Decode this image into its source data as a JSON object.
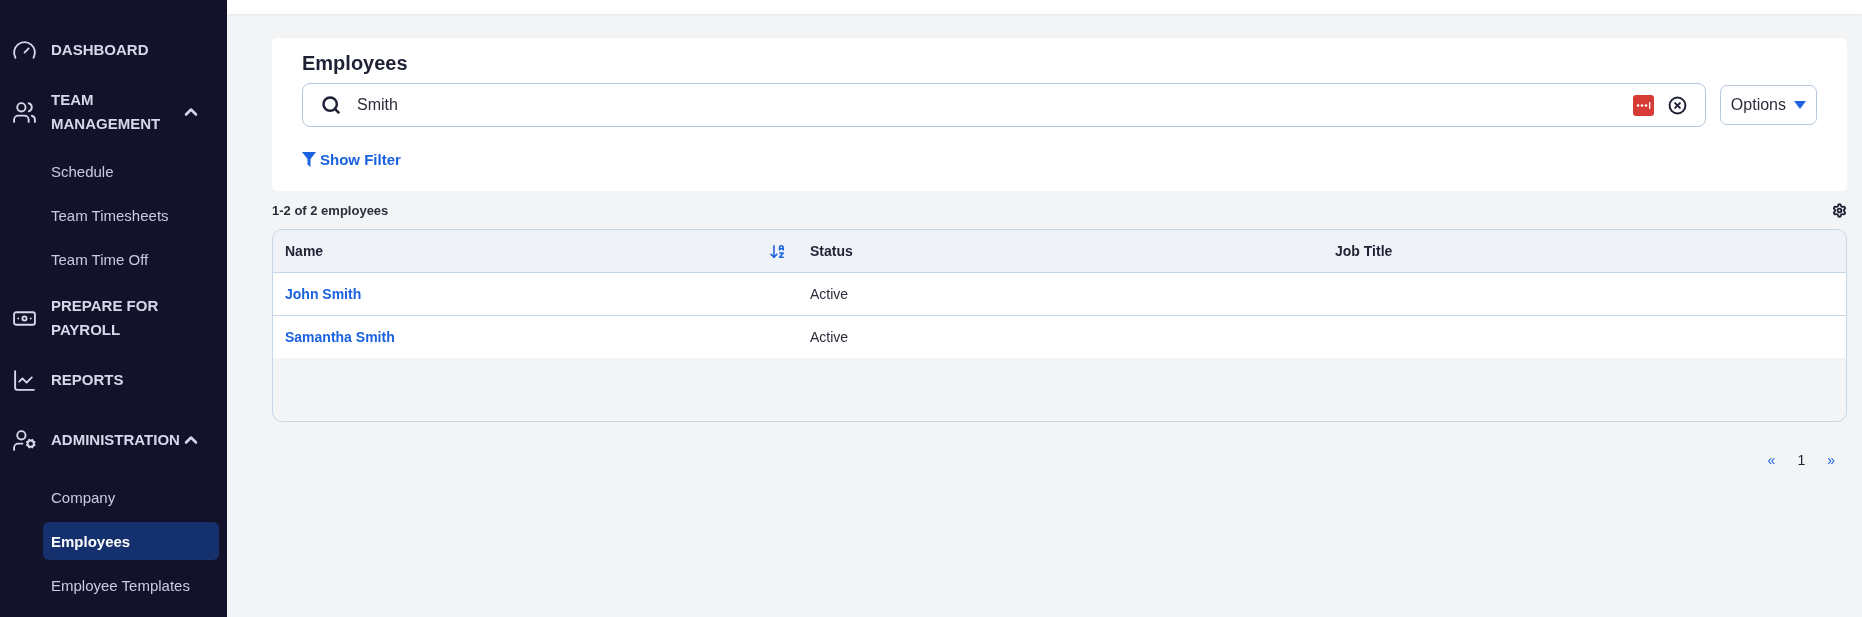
{
  "sidebar": {
    "sections": [
      {
        "label": "DASHBOARD"
      },
      {
        "label": "TEAM MANAGEMENT",
        "expanded": true,
        "items": [
          {
            "label": "Schedule",
            "selected": false
          },
          {
            "label": "Team Timesheets",
            "selected": false
          },
          {
            "label": "Team Time Off",
            "selected": false
          }
        ]
      },
      {
        "label": "PREPARE FOR PAYROLL"
      },
      {
        "label": "REPORTS"
      },
      {
        "label": "ADMINISTRATION",
        "expanded": true,
        "items": [
          {
            "label": "Company",
            "selected": false
          },
          {
            "label": "Employees",
            "selected": true
          },
          {
            "label": "Employee Templates",
            "selected": false
          }
        ]
      }
    ]
  },
  "page": {
    "title": "Employees",
    "search": {
      "value": "Smith"
    },
    "options_button": "Options",
    "filter_link": "Show Filter"
  },
  "results_count": "1-2 of 2 employees",
  "table": {
    "columns": [
      {
        "label": "Name",
        "sorted": true
      },
      {
        "label": "Status",
        "sorted": false
      },
      {
        "label": "Job Title",
        "sorted": false
      }
    ],
    "rows": [
      {
        "name": "John Smith",
        "status": "Active"
      },
      {
        "name": "Samantha Smith",
        "status": "Active"
      }
    ]
  },
  "pagination": {
    "prev": "«",
    "next": "»",
    "pages": [
      {
        "label": "1",
        "selected": true
      }
    ]
  }
}
